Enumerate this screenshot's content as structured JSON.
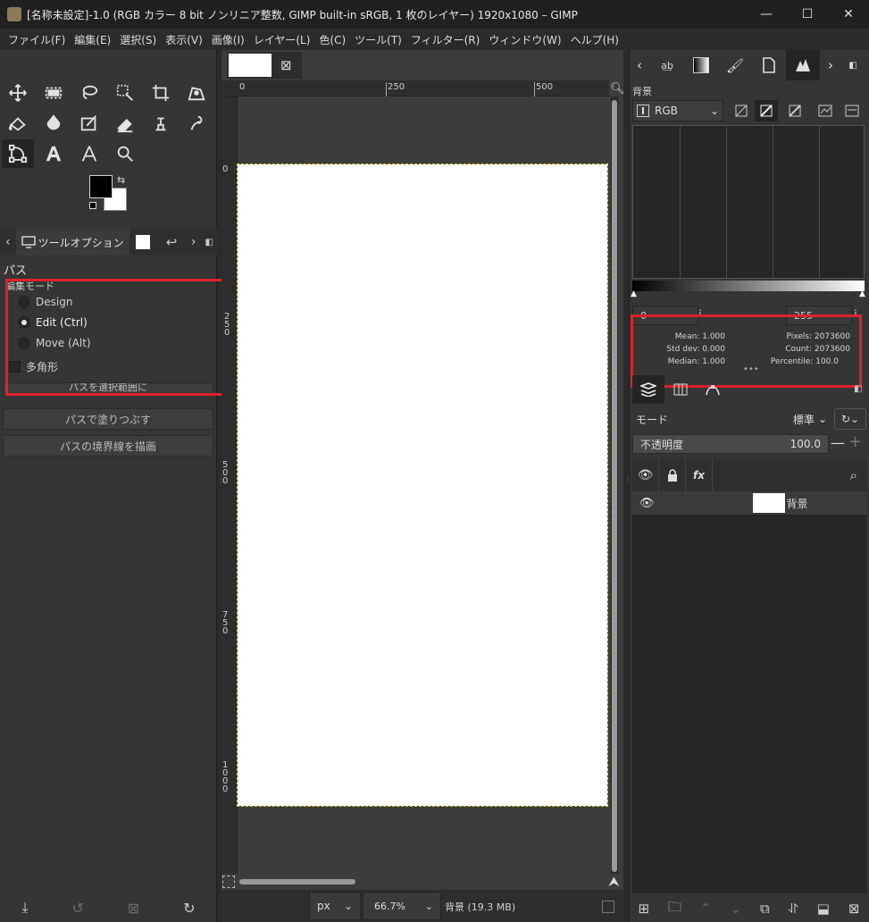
{
  "window": {
    "title": "[名称未設定]-1.0 (RGB カラー 8 bit ノンリニア整数, GIMP built-in sRGB, 1 枚のレイヤー) 1920x1080 – GIMP",
    "minimize": "—",
    "maximize": "☐",
    "close": "✕"
  },
  "menu": [
    "ファイル(F)",
    "編集(E)",
    "選択(S)",
    "表示(V)",
    "画像(I)",
    "レイヤー(L)",
    "色(C)",
    "ツール(T)",
    "フィルター(R)",
    "ウィンドウ(W)",
    "ヘルプ(H)"
  ],
  "tool_options": {
    "tab_label": "ツールオプション",
    "section_title": "パス",
    "sub_title": "編集モード",
    "modes": [
      {
        "label": "Design",
        "selected": false
      },
      {
        "label": "Edit (Ctrl)",
        "selected": true
      },
      {
        "label": "Move (Alt)",
        "selected": false
      }
    ],
    "polygon_label": "多角形",
    "buttons": [
      "パスを選択範囲に",
      "パスで塗りつぶす",
      "パスの境界線を描画"
    ]
  },
  "canvas": {
    "ruler_h": [
      "0",
      "250",
      "500"
    ],
    "ruler_v": [
      "0",
      "250",
      "500",
      "750",
      "1000"
    ],
    "unit": "px",
    "zoom": "66.7%",
    "status": "背景 (19.3 MB)"
  },
  "histogram": {
    "title": "背景",
    "channel": "RGB",
    "range_low": "0",
    "range_high": "255",
    "stats": {
      "mean_label": "Mean:",
      "mean": "1.000",
      "std_label": "Std dev:",
      "std": "0.000",
      "median_label": "Median:",
      "median": "1.000",
      "pixels_label": "Pixels:",
      "pixels": "2073600",
      "count_label": "Count:",
      "count": "2073600",
      "percentile_label": "Percentile:",
      "percentile": "100.0"
    }
  },
  "layers": {
    "mode_label": "モード",
    "mode_value": "標準",
    "opacity_label": "不透明度",
    "opacity_value": "100.0",
    "items": [
      {
        "name": "背景"
      }
    ]
  },
  "colors": {
    "highlight": "#e0202b",
    "fg": "#000000",
    "bg": "#ffffff"
  }
}
